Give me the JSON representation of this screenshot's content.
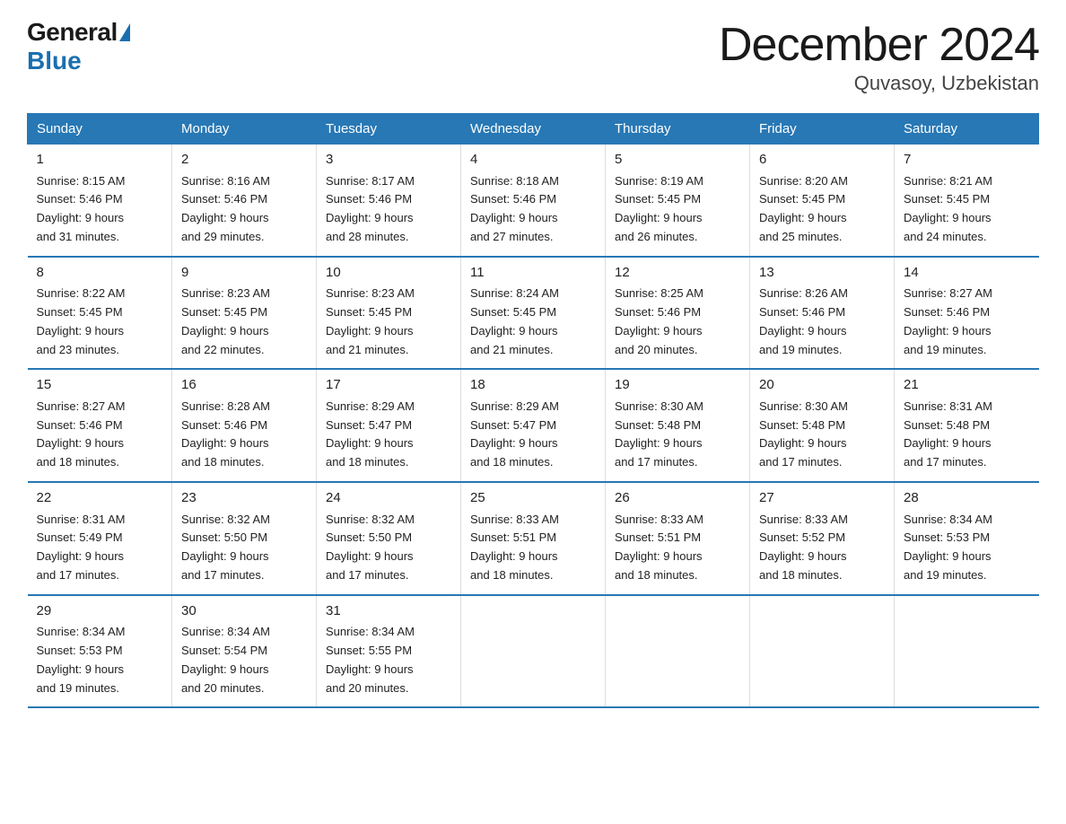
{
  "logo": {
    "general": "General",
    "blue": "Blue"
  },
  "title": "December 2024",
  "subtitle": "Quvasoy, Uzbekistan",
  "days_of_week": [
    "Sunday",
    "Monday",
    "Tuesday",
    "Wednesday",
    "Thursday",
    "Friday",
    "Saturday"
  ],
  "weeks": [
    [
      {
        "day": "1",
        "sunrise": "8:15 AM",
        "sunset": "5:46 PM",
        "daylight": "9 hours and 31 minutes."
      },
      {
        "day": "2",
        "sunrise": "8:16 AM",
        "sunset": "5:46 PM",
        "daylight": "9 hours and 29 minutes."
      },
      {
        "day": "3",
        "sunrise": "8:17 AM",
        "sunset": "5:46 PM",
        "daylight": "9 hours and 28 minutes."
      },
      {
        "day": "4",
        "sunrise": "8:18 AM",
        "sunset": "5:46 PM",
        "daylight": "9 hours and 27 minutes."
      },
      {
        "day": "5",
        "sunrise": "8:19 AM",
        "sunset": "5:45 PM",
        "daylight": "9 hours and 26 minutes."
      },
      {
        "day": "6",
        "sunrise": "8:20 AM",
        "sunset": "5:45 PM",
        "daylight": "9 hours and 25 minutes."
      },
      {
        "day": "7",
        "sunrise": "8:21 AM",
        "sunset": "5:45 PM",
        "daylight": "9 hours and 24 minutes."
      }
    ],
    [
      {
        "day": "8",
        "sunrise": "8:22 AM",
        "sunset": "5:45 PM",
        "daylight": "9 hours and 23 minutes."
      },
      {
        "day": "9",
        "sunrise": "8:23 AM",
        "sunset": "5:45 PM",
        "daylight": "9 hours and 22 minutes."
      },
      {
        "day": "10",
        "sunrise": "8:23 AM",
        "sunset": "5:45 PM",
        "daylight": "9 hours and 21 minutes."
      },
      {
        "day": "11",
        "sunrise": "8:24 AM",
        "sunset": "5:45 PM",
        "daylight": "9 hours and 21 minutes."
      },
      {
        "day": "12",
        "sunrise": "8:25 AM",
        "sunset": "5:46 PM",
        "daylight": "9 hours and 20 minutes."
      },
      {
        "day": "13",
        "sunrise": "8:26 AM",
        "sunset": "5:46 PM",
        "daylight": "9 hours and 19 minutes."
      },
      {
        "day": "14",
        "sunrise": "8:27 AM",
        "sunset": "5:46 PM",
        "daylight": "9 hours and 19 minutes."
      }
    ],
    [
      {
        "day": "15",
        "sunrise": "8:27 AM",
        "sunset": "5:46 PM",
        "daylight": "9 hours and 18 minutes."
      },
      {
        "day": "16",
        "sunrise": "8:28 AM",
        "sunset": "5:46 PM",
        "daylight": "9 hours and 18 minutes."
      },
      {
        "day": "17",
        "sunrise": "8:29 AM",
        "sunset": "5:47 PM",
        "daylight": "9 hours and 18 minutes."
      },
      {
        "day": "18",
        "sunrise": "8:29 AM",
        "sunset": "5:47 PM",
        "daylight": "9 hours and 18 minutes."
      },
      {
        "day": "19",
        "sunrise": "8:30 AM",
        "sunset": "5:48 PM",
        "daylight": "9 hours and 17 minutes."
      },
      {
        "day": "20",
        "sunrise": "8:30 AM",
        "sunset": "5:48 PM",
        "daylight": "9 hours and 17 minutes."
      },
      {
        "day": "21",
        "sunrise": "8:31 AM",
        "sunset": "5:48 PM",
        "daylight": "9 hours and 17 minutes."
      }
    ],
    [
      {
        "day": "22",
        "sunrise": "8:31 AM",
        "sunset": "5:49 PM",
        "daylight": "9 hours and 17 minutes."
      },
      {
        "day": "23",
        "sunrise": "8:32 AM",
        "sunset": "5:50 PM",
        "daylight": "9 hours and 17 minutes."
      },
      {
        "day": "24",
        "sunrise": "8:32 AM",
        "sunset": "5:50 PM",
        "daylight": "9 hours and 17 minutes."
      },
      {
        "day": "25",
        "sunrise": "8:33 AM",
        "sunset": "5:51 PM",
        "daylight": "9 hours and 18 minutes."
      },
      {
        "day": "26",
        "sunrise": "8:33 AM",
        "sunset": "5:51 PM",
        "daylight": "9 hours and 18 minutes."
      },
      {
        "day": "27",
        "sunrise": "8:33 AM",
        "sunset": "5:52 PM",
        "daylight": "9 hours and 18 minutes."
      },
      {
        "day": "28",
        "sunrise": "8:34 AM",
        "sunset": "5:53 PM",
        "daylight": "9 hours and 19 minutes."
      }
    ],
    [
      {
        "day": "29",
        "sunrise": "8:34 AM",
        "sunset": "5:53 PM",
        "daylight": "9 hours and 19 minutes."
      },
      {
        "day": "30",
        "sunrise": "8:34 AM",
        "sunset": "5:54 PM",
        "daylight": "9 hours and 20 minutes."
      },
      {
        "day": "31",
        "sunrise": "8:34 AM",
        "sunset": "5:55 PM",
        "daylight": "9 hours and 20 minutes."
      },
      null,
      null,
      null,
      null
    ]
  ],
  "labels": {
    "sunrise": "Sunrise:",
    "sunset": "Sunset:",
    "daylight": "Daylight:"
  }
}
